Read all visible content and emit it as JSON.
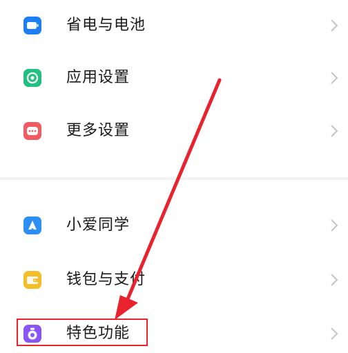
{
  "settings_list": {
    "items": [
      {
        "label": "省电与电池",
        "icon": "battery-icon",
        "color": "#1e7ff2"
      },
      {
        "label": "应用设置",
        "icon": "app-settings-gear-icon",
        "color": "#23c081"
      },
      {
        "label": "更多设置",
        "icon": "more-dots-icon",
        "color": "#f05c61"
      },
      {
        "label": "小爱同学",
        "icon": "xiaoai-assistant-icon",
        "color": "#2d8ef6"
      },
      {
        "label": "钱包与支付",
        "icon": "wallet-icon",
        "color": "#f4bd2a"
      },
      {
        "label": "特色功能",
        "icon": "special-features-icon",
        "color": "#8a55f5"
      }
    ]
  },
  "annotation": {
    "arrow_color": "#e8232e",
    "highlighted_item": "特色功能"
  }
}
